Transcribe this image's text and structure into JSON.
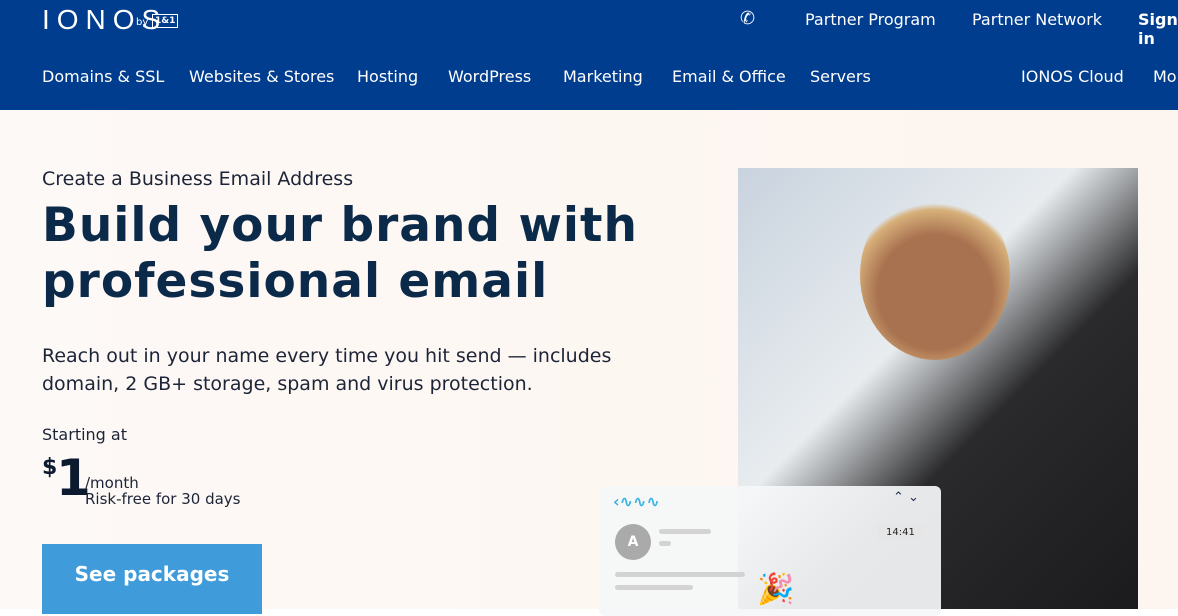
{
  "header": {
    "logo": "IONOS",
    "logo_by": "by",
    "logo_partner": "1&1",
    "top_links": [
      "Partner Program",
      "Partner Network",
      "Sign in"
    ],
    "nav": [
      "Domains & SSL",
      "Websites & Stores",
      "Hosting",
      "WordPress",
      "Marketing",
      "Email & Office",
      "Servers",
      "IONOS Cloud",
      "More"
    ]
  },
  "hero": {
    "subtitle": "Create a Business Email Address",
    "title": "Build your brand with professional email",
    "description": "Reach out in your name every time you hit send — includes domain, 2 GB+ storage, spam and virus protection.",
    "starting_at": "Starting at",
    "currency": "$",
    "price": "1",
    "period": "/month",
    "risk_free": "Risk-free for 30 days",
    "cta": "See packages"
  },
  "mock_email": {
    "avatar_letter": "A",
    "time": "14:41"
  }
}
